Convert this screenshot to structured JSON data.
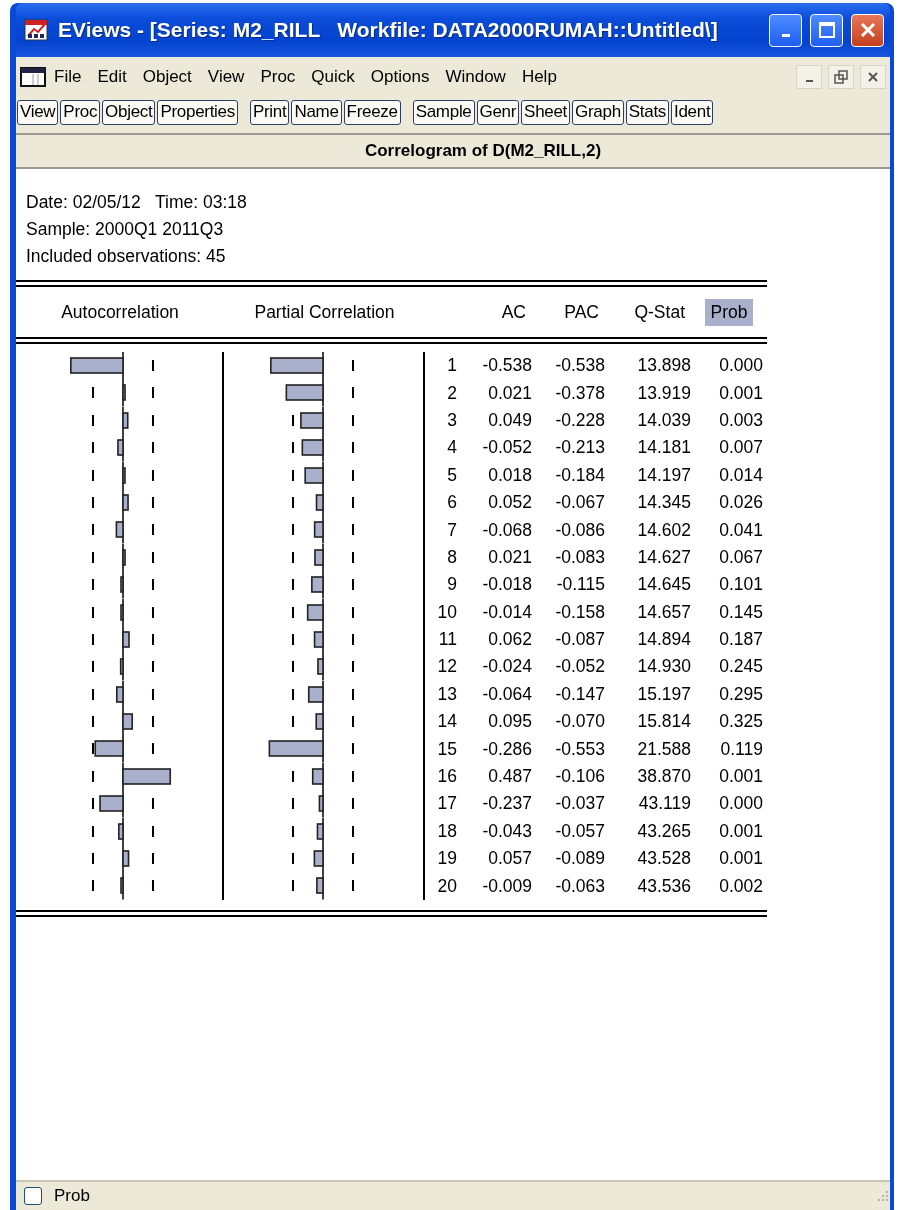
{
  "window": {
    "title": "EViews - [Series: M2_RILL   Workfile: DATA2000RUMAH::Untitled\\]"
  },
  "menu": [
    "File",
    "Edit",
    "Object",
    "View",
    "Proc",
    "Quick",
    "Options",
    "Window",
    "Help"
  ],
  "toolbar": [
    [
      "View",
      "Proc",
      "Object",
      "Properties"
    ],
    [
      "Print",
      "Name",
      "Freeze"
    ],
    [
      "Sample",
      "Genr",
      "Sheet",
      "Graph",
      "Stats",
      "Ident"
    ]
  ],
  "view_title": "Correlogram of D(M2_RILL,2)",
  "info": [
    "Date: 02/05/12   Time: 03:18",
    "Sample: 2000Q1 2011Q3",
    "Included observations: 45"
  ],
  "table": {
    "columns": [
      {
        "label": "Autocorrelation",
        "selected": false
      },
      {
        "label": "Partial Correlation",
        "selected": false
      },
      {
        "label": "AC",
        "selected": false
      },
      {
        "label": "PAC",
        "selected": false
      },
      {
        "label": "Q-Stat",
        "selected": false
      },
      {
        "label": "Prob",
        "selected": true
      }
    ],
    "rows": [
      {
        "lag": "1",
        "ac": "-0.538",
        "pac": "-0.538",
        "q_stat": "13.898",
        "prob": "0.000"
      },
      {
        "lag": "2",
        "ac": "0.021",
        "pac": "-0.378",
        "q_stat": "13.919",
        "prob": "0.001"
      },
      {
        "lag": "3",
        "ac": "0.049",
        "pac": "-0.228",
        "q_stat": "14.039",
        "prob": "0.003"
      },
      {
        "lag": "4",
        "ac": "-0.052",
        "pac": "-0.213",
        "q_stat": "14.181",
        "prob": "0.007"
      },
      {
        "lag": "5",
        "ac": "0.018",
        "pac": "-0.184",
        "q_stat": "14.197",
        "prob": "0.014"
      },
      {
        "lag": "6",
        "ac": "0.052",
        "pac": "-0.067",
        "q_stat": "14.345",
        "prob": "0.026"
      },
      {
        "lag": "7",
        "ac": "-0.068",
        "pac": "-0.086",
        "q_stat": "14.602",
        "prob": "0.041"
      },
      {
        "lag": "8",
        "ac": "0.021",
        "pac": "-0.083",
        "q_stat": "14.627",
        "prob": "0.067"
      },
      {
        "lag": "9",
        "ac": "-0.018",
        "pac": "-0.115",
        "q_stat": "14.645",
        "prob": "0.101"
      },
      {
        "lag": "10",
        "ac": "-0.014",
        "pac": "-0.158",
        "q_stat": "14.657",
        "prob": "0.145"
      },
      {
        "lag": "11",
        "ac": "0.062",
        "pac": "-0.087",
        "q_stat": "14.894",
        "prob": "0.187"
      },
      {
        "lag": "12",
        "ac": "-0.024",
        "pac": "-0.052",
        "q_stat": "14.930",
        "prob": "0.245"
      },
      {
        "lag": "13",
        "ac": "-0.064",
        "pac": "-0.147",
        "q_stat": "15.197",
        "prob": "0.295"
      },
      {
        "lag": "14",
        "ac": "0.095",
        "pac": "-0.070",
        "q_stat": "15.814",
        "prob": "0.325"
      },
      {
        "lag": "15",
        "ac": "-0.286",
        "pac": "-0.553",
        "q_stat": "21.588",
        "prob": "0.119"
      },
      {
        "lag": "16",
        "ac": "0.487",
        "pac": "-0.106",
        "q_stat": "38.870",
        "prob": "0.001"
      },
      {
        "lag": "17",
        "ac": "-0.237",
        "pac": "-0.037",
        "q_stat": "43.119",
        "prob": "0.000"
      },
      {
        "lag": "18",
        "ac": "-0.043",
        "pac": "-0.057",
        "q_stat": "43.265",
        "prob": "0.001"
      },
      {
        "lag": "19",
        "ac": "0.057",
        "pac": "-0.089",
        "q_stat": "43.528",
        "prob": "0.001"
      },
      {
        "lag": "20",
        "ac": "-0.009",
        "pac": "-0.063",
        "q_stat": "43.536",
        "prob": "0.002"
      }
    ]
  },
  "status_bar": {
    "checked": false,
    "text": "Prob"
  }
}
